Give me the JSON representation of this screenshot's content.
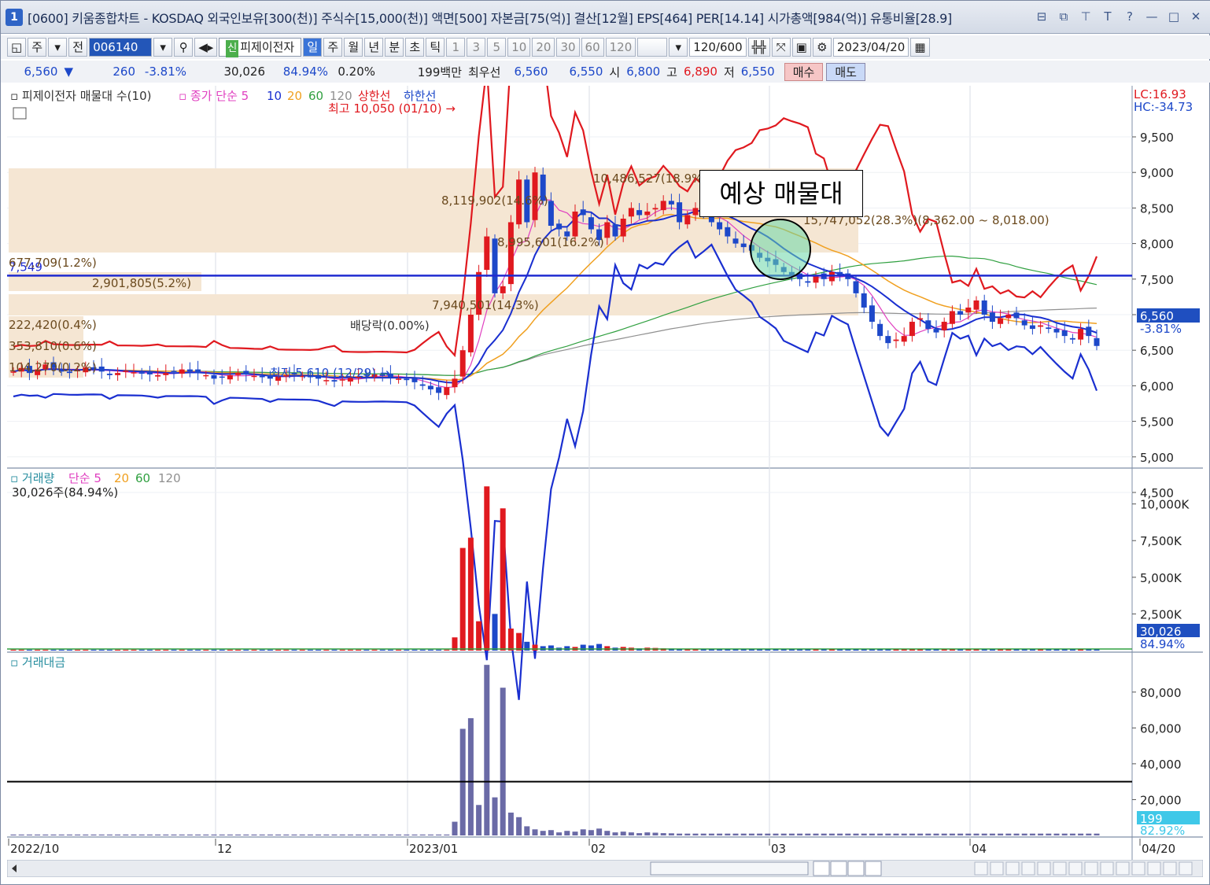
{
  "window": {
    "number": "1",
    "title": "[0600] 키움종합차트 - KOSDAQ 외국인보유[300(천)] 주식수[15,000(천)] 액면[500] 자본금[75(억)] 결산[12월] EPS[464] PER[14.14] 시가총액[984(억)] 유통비율[28.9]",
    "controls": [
      "⊟",
      "⧉",
      "⊤",
      "T",
      "?",
      "—",
      "□",
      "✕"
    ]
  },
  "toolbar1": {
    "market": "주",
    "prev": "전",
    "code": "006140",
    "stock_name_badge": "신",
    "stock_name": "피제이전자",
    "periods": [
      "일",
      "주",
      "월",
      "년",
      "분",
      "초",
      "틱"
    ],
    "selected_period": "일",
    "intervals": [
      "1",
      "3",
      "5",
      "10",
      "20",
      "30",
      "60",
      "120"
    ],
    "count": "120",
    "count_max": "/600",
    "date": "2023/04/20"
  },
  "toolbar2": {
    "price": "6,560",
    "arrow": "▼",
    "change": "260",
    "change_pct": "-3.81%",
    "volume": "30,026",
    "vol_ratio": "84.94%",
    "turnover": "0.20%",
    "amount": "199백만",
    "best_label": "최우선",
    "ask": "6,560",
    "bid": "6,550",
    "open_label": "시",
    "open": "6,800",
    "high_label": "고",
    "high": "6,890",
    "low_label": "저",
    "low": "6,550",
    "buy": "매수",
    "sell": "매도"
  },
  "price_panel": {
    "legend_title": "피제이전자 매물대 수(10)",
    "legend_ma": "종가 단순 5",
    "ma_periods": [
      "10",
      "20",
      "60",
      "120"
    ],
    "upper_limit": "상한선",
    "lower_limit": "하한선",
    "max_label": "최고 10,050 (01/10)",
    "min_label": "최저 5,610 (12/29)",
    "dividend_label": "배당락(0.00%)",
    "lc": "LC:16.93",
    "hc": "HC:-34.73",
    "hline_value": "7,549",
    "current_price": "6,560",
    "current_pct": "-3.81%",
    "y_ticks": [
      "9,500",
      "9,000",
      "8,500",
      "8,000",
      "7,500",
      "7,000",
      "6,500",
      "6,000",
      "5,500",
      "5,000",
      "4,500"
    ],
    "volume_profile_labels": [
      "10,486,527(18.9%)",
      "8,119,902(14.6%)",
      "8,995,601(16.2%)",
      "15,747,052(28.3%)(8,362.00 ~ 8,018.00)",
      "677,709(1.2%)",
      "2,901,805(5.2%)",
      "7,940,501(14.3%)",
      "222,420(0.4%)",
      "353,810(0.6%)",
      "104,270(0.2%)"
    ]
  },
  "annotation": {
    "label": "예상 매물대"
  },
  "volume_panel": {
    "legend_title": "거래량",
    "legend_ma": "단순 5",
    "ma_periods": [
      "20",
      "60",
      "120"
    ],
    "value_line": "30,026주(84.94%)",
    "y_ticks": [
      "10,000K",
      "7,500K",
      "5,000K",
      "2,500K"
    ],
    "current": "30,026",
    "current_pct": "84.94%"
  },
  "amount_panel": {
    "legend_title": "거래대금",
    "y_ticks": [
      "80,000",
      "60,000",
      "40,000",
      "20,000"
    ],
    "current": "199",
    "current_pct": "82.92%"
  },
  "x_axis": {
    "labels": [
      "2022/10",
      "12",
      "2023/01",
      "02",
      "03",
      "04",
      "04/20"
    ]
  },
  "colors": {
    "up": "#e0191f",
    "down": "#1d48c9",
    "profile": "#f5e6d3",
    "ma5": "#e040c0",
    "ma10": "#1a2fd0",
    "ma20": "#f0a020",
    "ma60": "#30a040",
    "ma120": "#909090",
    "upper": "#e0191f",
    "lower": "#1a2fd0",
    "amount_bar": "#6a6aa6"
  }
}
